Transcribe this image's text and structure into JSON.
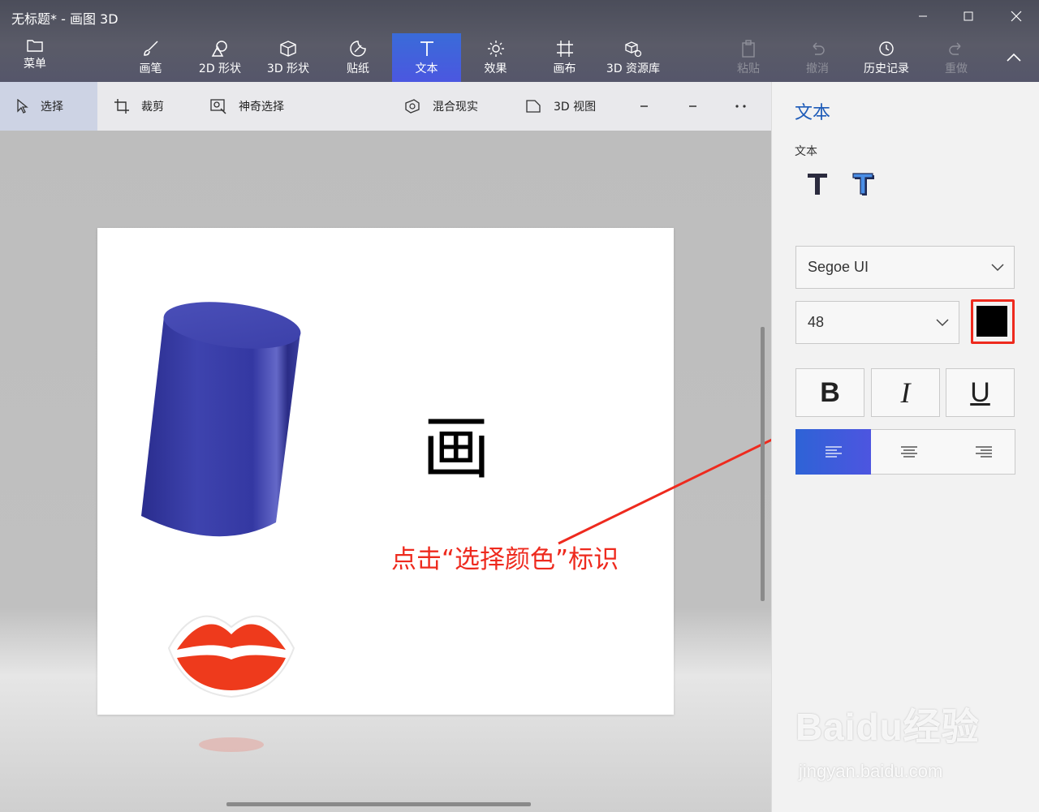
{
  "window": {
    "title": "无标题* - 画图 3D"
  },
  "ribbon": {
    "menu_label": "菜单",
    "tools": [
      {
        "label": "画笔",
        "icon": "brush-icon"
      },
      {
        "label": "2D 形状",
        "icon": "2d-shapes-icon"
      },
      {
        "label": "3D 形状",
        "icon": "3d-shapes-icon"
      },
      {
        "label": "贴纸",
        "icon": "stickers-icon"
      },
      {
        "label": "文本",
        "icon": "text-icon",
        "active": true
      },
      {
        "label": "效果",
        "icon": "effects-icon"
      },
      {
        "label": "画布",
        "icon": "canvas-icon"
      },
      {
        "label": "3D 资源库",
        "icon": "3d-library-icon"
      }
    ],
    "paste_label": "粘贴",
    "undo_label": "撤消",
    "history_label": "历史记录",
    "redo_label": "重做"
  },
  "subtoolbar": {
    "select_label": "选择",
    "crop_label": "裁剪",
    "magic_select_label": "神奇选择",
    "mixed_reality_label": "混合现实",
    "view3d_label": "3D 视图"
  },
  "canvas": {
    "text_glyph": "画",
    "annotation": "点击“选择颜色”标识",
    "annotation_color": "#ee2a1e"
  },
  "panel": {
    "title": "文本",
    "subtitle": "文本",
    "font_family": "Segoe UI",
    "font_size": "48",
    "color": "#000000",
    "bold_label": "B",
    "italic_label": "I",
    "underline_label": "U",
    "alignment": "left"
  },
  "watermark": {
    "logo": "Baidu经验",
    "url": "jingyan.baidu.com"
  },
  "colors": {
    "accent": "#3a6bd8",
    "panel_title": "#1d5bb8",
    "cylinder": "#3a3fa8",
    "lips": "#ee3a1c"
  }
}
